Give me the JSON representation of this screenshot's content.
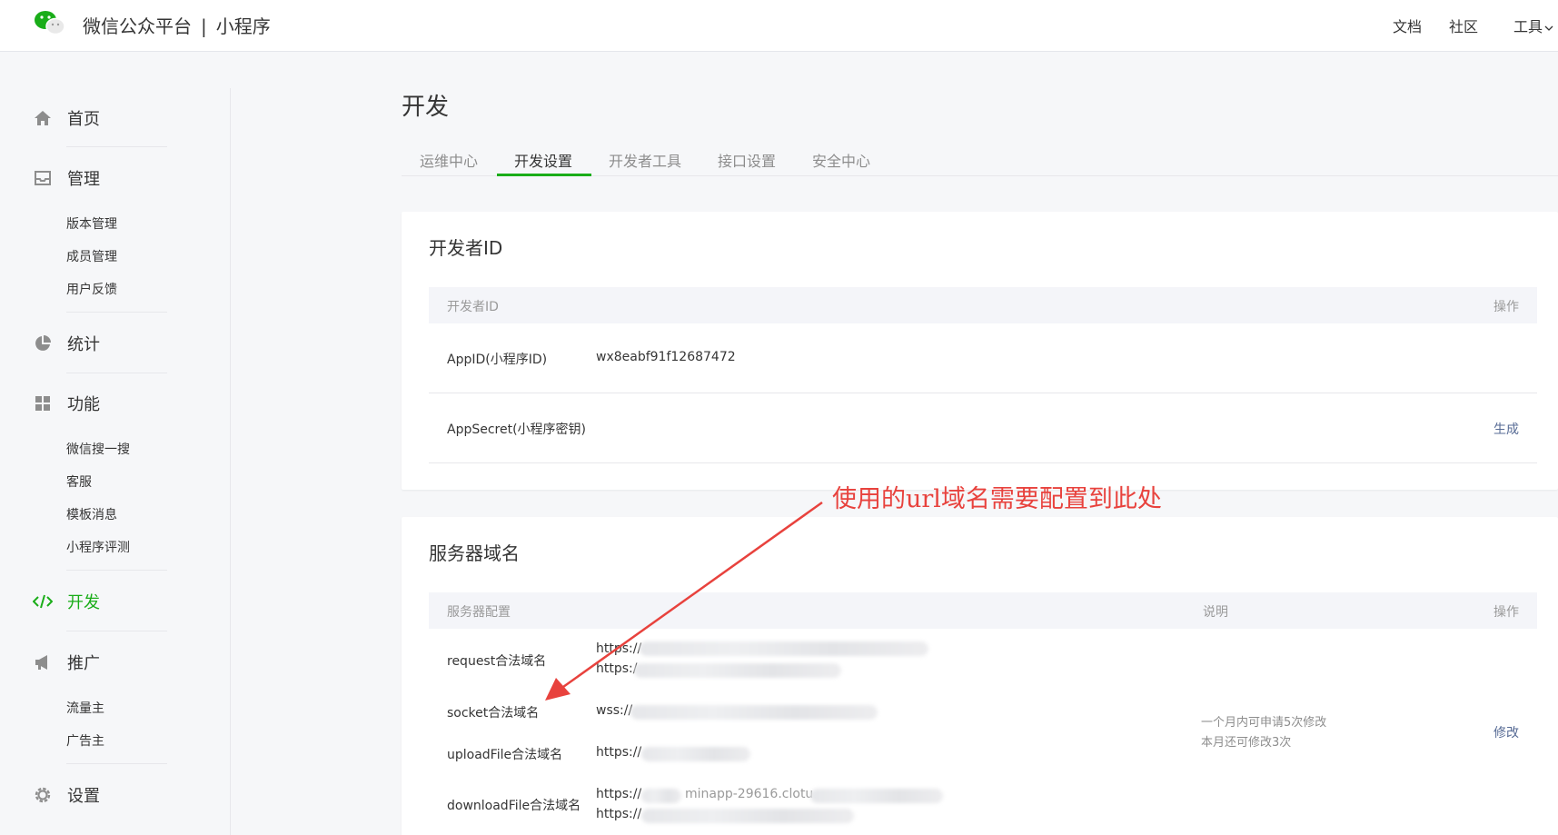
{
  "header": {
    "brand_main": "微信公众平台",
    "brand_separator": "|",
    "brand_sub": "小程序",
    "links": {
      "docs": "文档",
      "community": "社区",
      "tools": "工具"
    }
  },
  "sidebar": {
    "home": "首页",
    "manage": "管理",
    "manage_items": [
      "版本管理",
      "成员管理",
      "用户反馈"
    ],
    "stats": "统计",
    "features": "功能",
    "feature_items": [
      "微信搜一搜",
      "客服",
      "模板消息",
      "小程序评测"
    ],
    "develop": "开发",
    "promote": "推广",
    "promote_items": [
      "流量主",
      "广告主"
    ],
    "settings": "设置"
  },
  "main": {
    "title": "开发",
    "tabs": [
      "运维中心",
      "开发设置",
      "开发者工具",
      "接口设置",
      "安全中心"
    ],
    "active_tab_index": 1
  },
  "developer_id": {
    "title": "开发者ID",
    "header_col1": "开发者ID",
    "header_action": "操作",
    "appid_label": "AppID(小程序ID)",
    "appid_value": "wx8eabf91f12687472",
    "secret_label": "AppSecret(小程序密钥)",
    "secret_action": "生成"
  },
  "server_domain": {
    "title": "服务器域名",
    "header_col1": "服务器配置",
    "header_desc": "说明",
    "header_action": "操作",
    "rows": [
      {
        "label": "request合法域名",
        "values": [
          "https://",
          "https:/"
        ]
      },
      {
        "label": "socket合法域名",
        "values": [
          "wss://"
        ]
      },
      {
        "label": "uploadFile合法域名",
        "values": [
          "https://"
        ]
      },
      {
        "label": "downloadFile合法域名",
        "values": [
          "https://",
          "https://"
        ]
      }
    ],
    "download_partial": "minapp-29616.clotu.",
    "desc_line1": "一个月内可申请5次修改",
    "desc_line2": "本月还可修改3次",
    "modify": "修改"
  },
  "annotation": {
    "text": "使用的url域名需要配置到此处",
    "color": "#e8423d"
  },
  "colors": {
    "accent": "#1aad19",
    "link": "#576b95"
  }
}
